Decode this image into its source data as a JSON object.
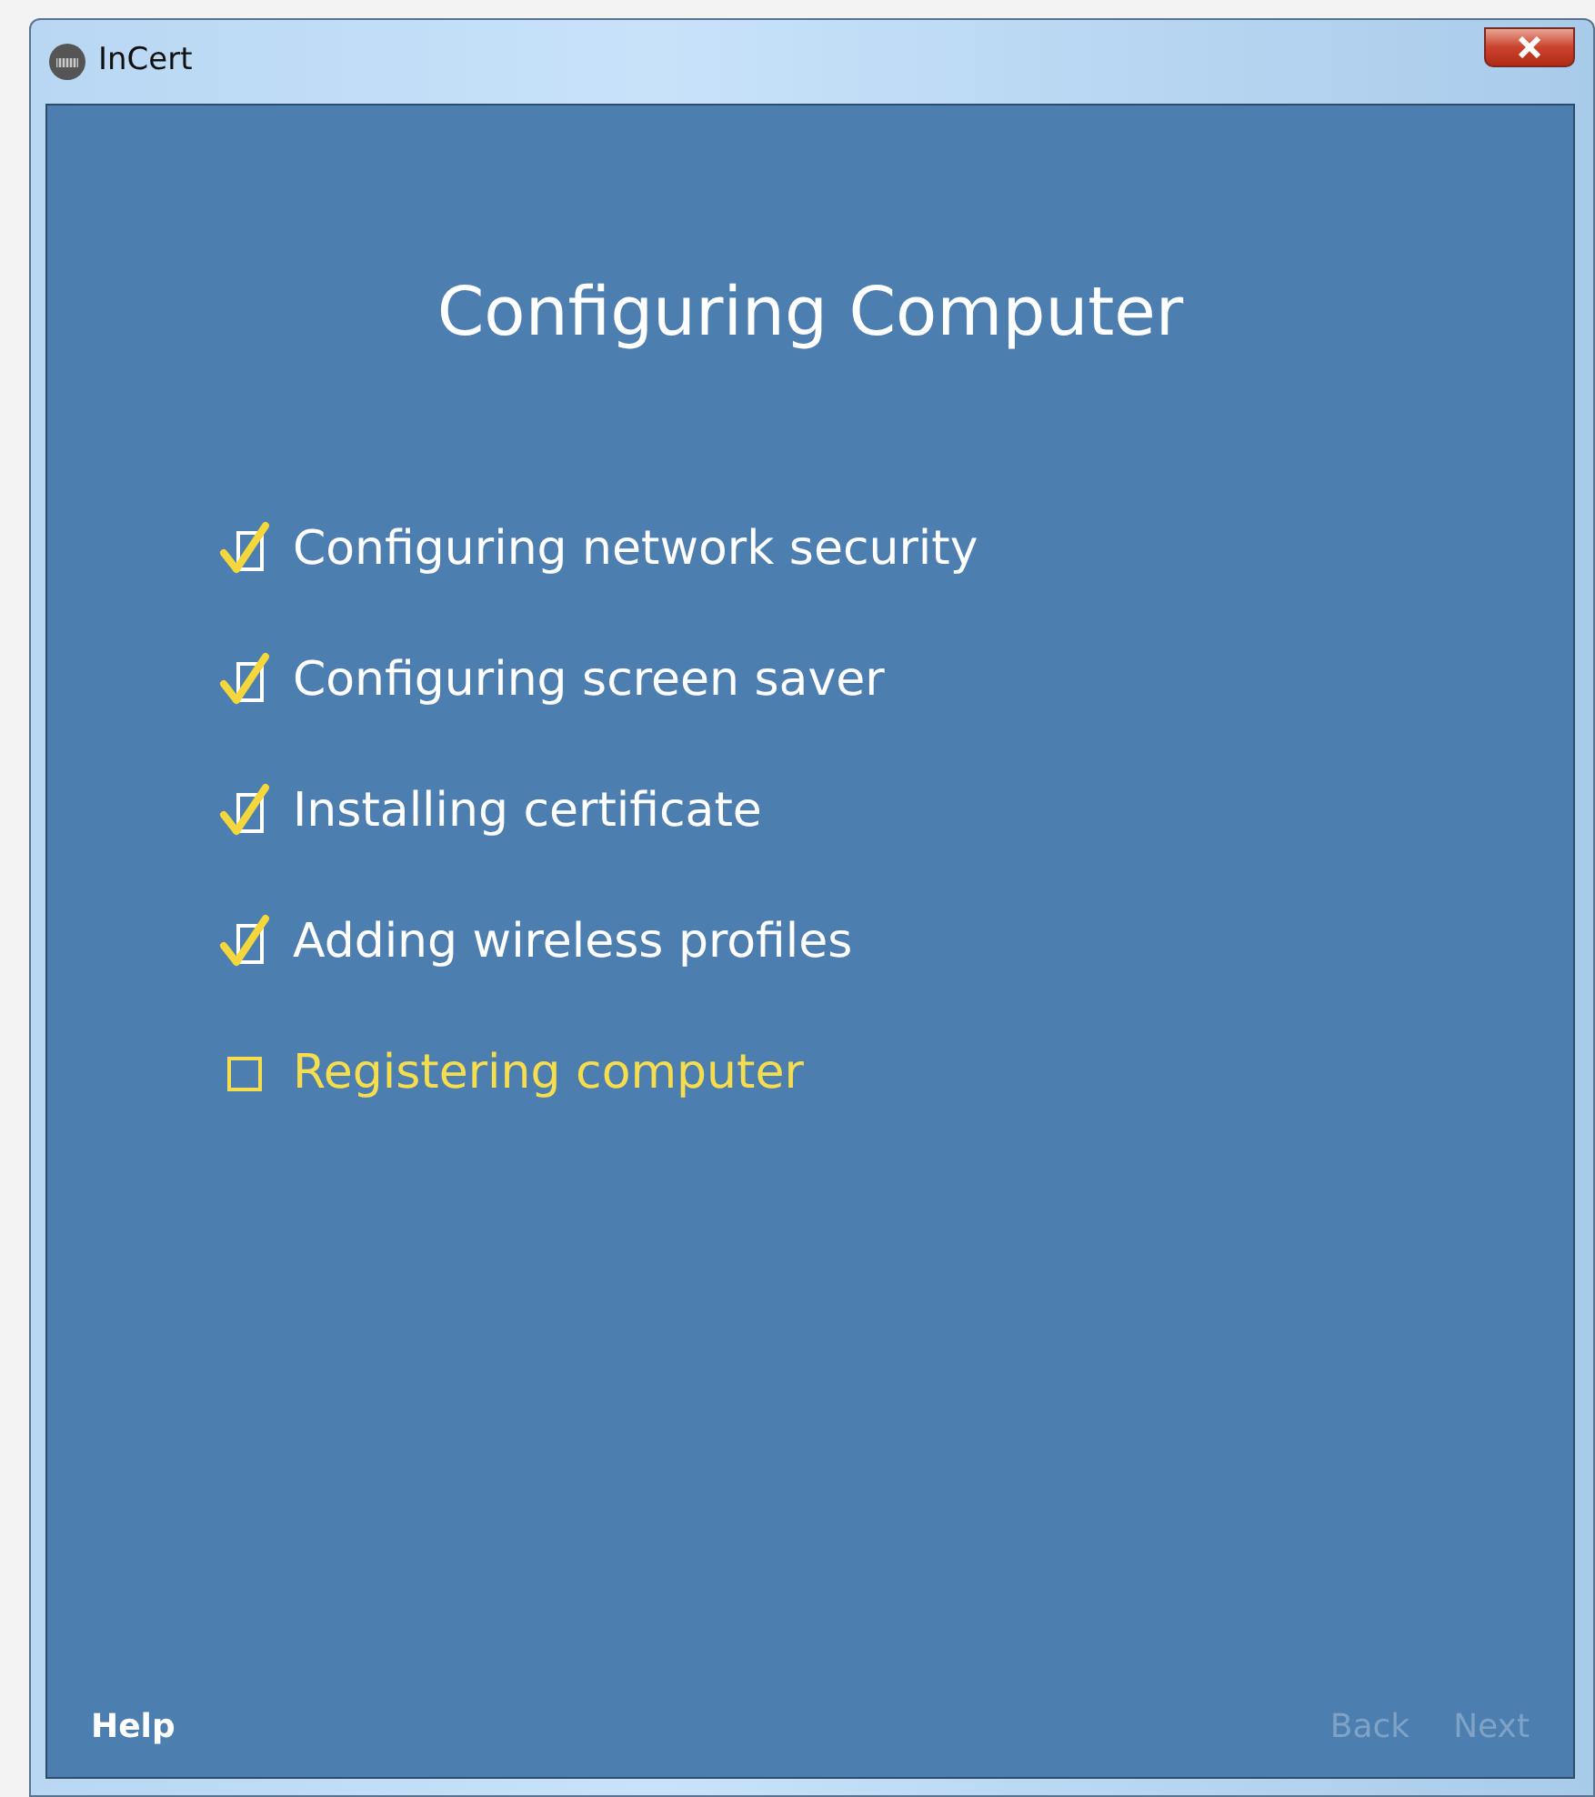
{
  "window": {
    "title": "InCert"
  },
  "heading": "Configuring Computer",
  "steps": [
    {
      "label": "Configuring network security",
      "checked": true
    },
    {
      "label": "Configuring screen saver",
      "checked": true
    },
    {
      "label": "Installing certificate",
      "checked": true
    },
    {
      "label": "Adding wireless profiles",
      "checked": true
    },
    {
      "label": "Registering computer",
      "checked": false
    }
  ],
  "footer": {
    "help": "Help",
    "buttons": [
      {
        "label": "Back",
        "disabled": true
      },
      {
        "label": "Next",
        "disabled": true
      }
    ]
  }
}
